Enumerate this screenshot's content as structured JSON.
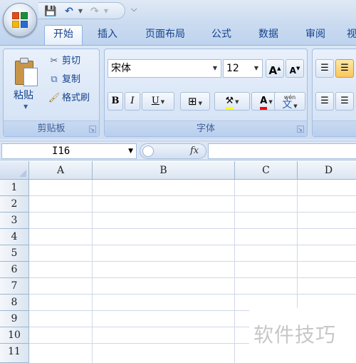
{
  "tabs": [
    "开始",
    "插入",
    "页面布局",
    "公式",
    "数据",
    "审阅",
    "视"
  ],
  "clipboard": {
    "paste_label": "粘贴",
    "cut_label": "剪切",
    "copy_label": "复制",
    "format_painter_label": "格式刷",
    "group_label": "剪贴板"
  },
  "font": {
    "name": "宋体",
    "size": "12",
    "grow_label": "A",
    "shrink_label": "A",
    "bold_label": "B",
    "italic_label": "I",
    "underline_label": "U",
    "font_color_label": "A",
    "phonetic_top": "wén",
    "phonetic_char": "文",
    "group_label": "字体",
    "fill_color": "#ffff00",
    "font_color": "#ff0000"
  },
  "formula_bar": {
    "name_box": "I16",
    "fx_label": "fx",
    "formula": ""
  },
  "grid": {
    "columns": [
      "A",
      "B",
      "C",
      "D"
    ],
    "rows": [
      "1",
      "2",
      "3",
      "4",
      "5",
      "6",
      "7",
      "8",
      "9",
      "10",
      "11"
    ]
  },
  "watermark": "软件技巧"
}
